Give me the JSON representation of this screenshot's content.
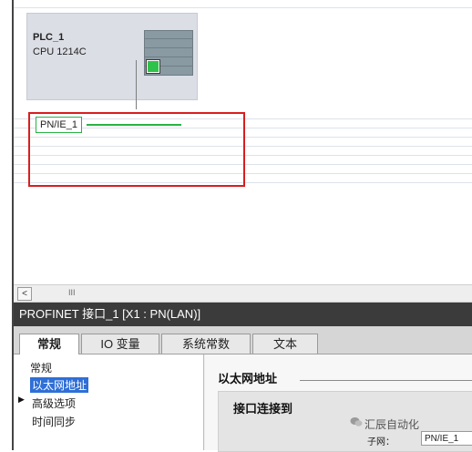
{
  "canvas": {
    "device": {
      "name": "PLC_1",
      "type": "CPU 1214C"
    },
    "network": {
      "label": "PN/IE_1"
    }
  },
  "scrollbar": {
    "left_arrow": "<",
    "thumb_grip": "III"
  },
  "properties": {
    "header": "PROFINET 接口_1 [X1 : PN(LAN)]",
    "tabs": [
      {
        "label": "常规",
        "active": true
      },
      {
        "label": "IO 变量",
        "active": false
      },
      {
        "label": "系统常数",
        "active": false
      },
      {
        "label": "文本",
        "active": false
      }
    ],
    "nav": {
      "items": [
        {
          "label": "常规",
          "selected": false
        },
        {
          "label": "以太网地址",
          "selected": true
        },
        {
          "label": "高级选项",
          "expandable": true
        },
        {
          "label": "时间同步",
          "selected": false
        }
      ]
    },
    "content": {
      "section_title": "以太网地址",
      "subsection_title": "接口连接到",
      "subnet_label": "子网：",
      "subnet_value": "PN/IE_1"
    }
  },
  "watermark": {
    "text": "汇辰自动化",
    "icon": "wechat-icon"
  },
  "colors": {
    "highlight": "#d81e1e",
    "network": "#27b344",
    "port": "#2fc24a",
    "selection": "#2f6fd6"
  }
}
